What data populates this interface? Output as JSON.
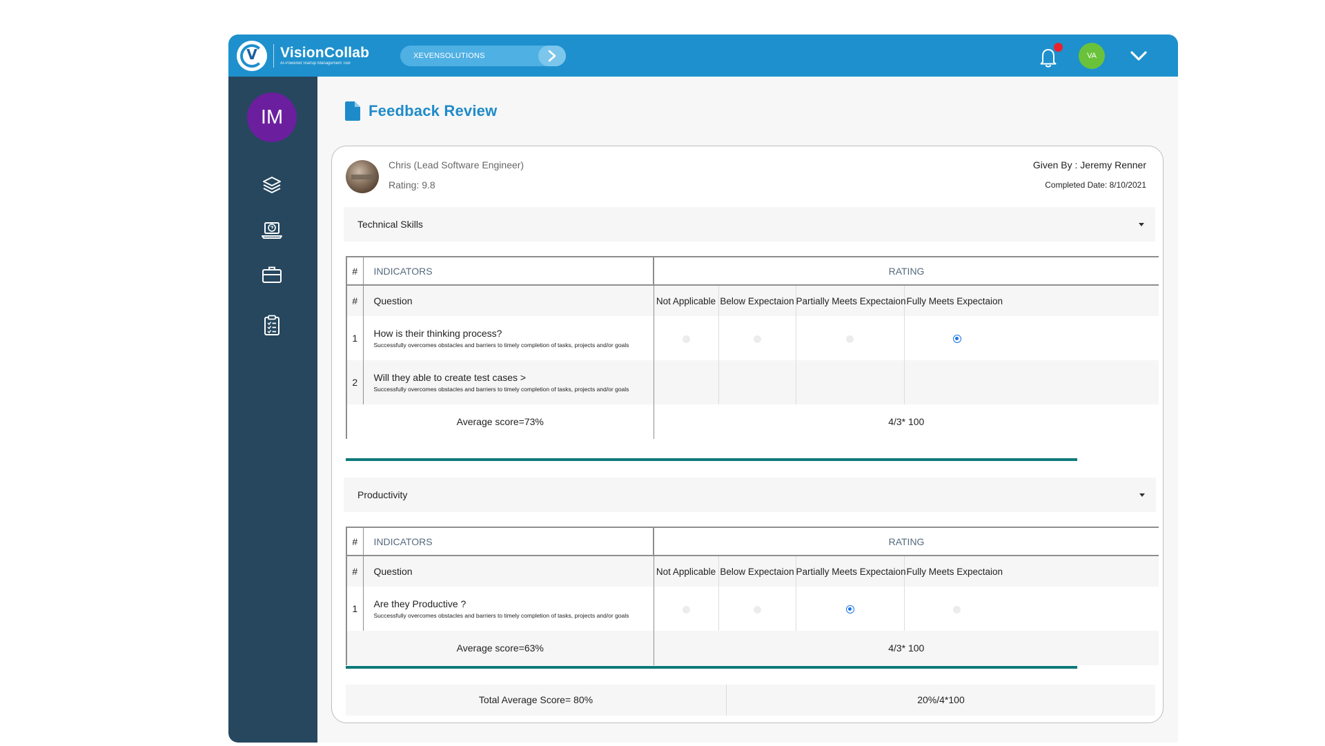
{
  "app": {
    "logo_name": "VisionCollab",
    "logo_tagline": "AI-Powered Startup Management Tool",
    "organization": "XEVENSOLUTIONS",
    "user_initials": "VA",
    "sidebar_avatar": "IM",
    "colors": {
      "topbar": "#1e90cd",
      "sidebar": "#26475e",
      "avatar": "#6b1f9e",
      "user_badge": "#6ac23b",
      "title": "#1e8bc9",
      "teal_divider": "#0e7979"
    },
    "icons": [
      "bell-icon",
      "chevron-down-icon",
      "layers-icon",
      "help-laptop-icon",
      "briefcase-icon",
      "clipboard-list-icon",
      "document-icon",
      "chevron-right-icon"
    ]
  },
  "page": {
    "title": "Feedback Review"
  },
  "review": {
    "person": "Chris (Lead Software Engineer)",
    "rating": "Rating: 9.8",
    "given_by": "Given By : Jeremy Renner",
    "completed_date": "Completed Date: 8/10/2021"
  },
  "columns": {
    "hash": "#",
    "indicators": "INDICATORS",
    "rating": "RATING",
    "question": "Question",
    "options": [
      "Not Applicable",
      "Below Expectaion",
      "Partially Meets Expectaion",
      "Fully Meets Expectaion"
    ]
  },
  "sections": [
    {
      "name": "Technical Skills",
      "questions": [
        {
          "num": "1",
          "text": "How is their thinking process?",
          "desc": "Successfully overcomes obstacles and barriers to timely completion of tasks, projects and/or goals",
          "selected": "Fully Meets Expectaion"
        },
        {
          "num": "2",
          "text": "Will they able to create test cases >",
          "desc": "Successfully overcomes obstacles and barriers to timely completion of tasks, projects and/or goals",
          "selected": ""
        }
      ],
      "average": "Average score=73%",
      "formula": "4/3* 100"
    },
    {
      "name": "Productivity",
      "questions": [
        {
          "num": "1",
          "text": "Are they Productive ?",
          "desc": "Successfully overcomes obstacles and barriers to timely completion of tasks, projects and/or goals",
          "selected": "Partially Meets Expectaion"
        }
      ],
      "average": "Average score=63%",
      "formula": "4/3* 100"
    }
  ],
  "total": {
    "label": "Total Average Score= 80%",
    "formula": "20%/4*100"
  }
}
